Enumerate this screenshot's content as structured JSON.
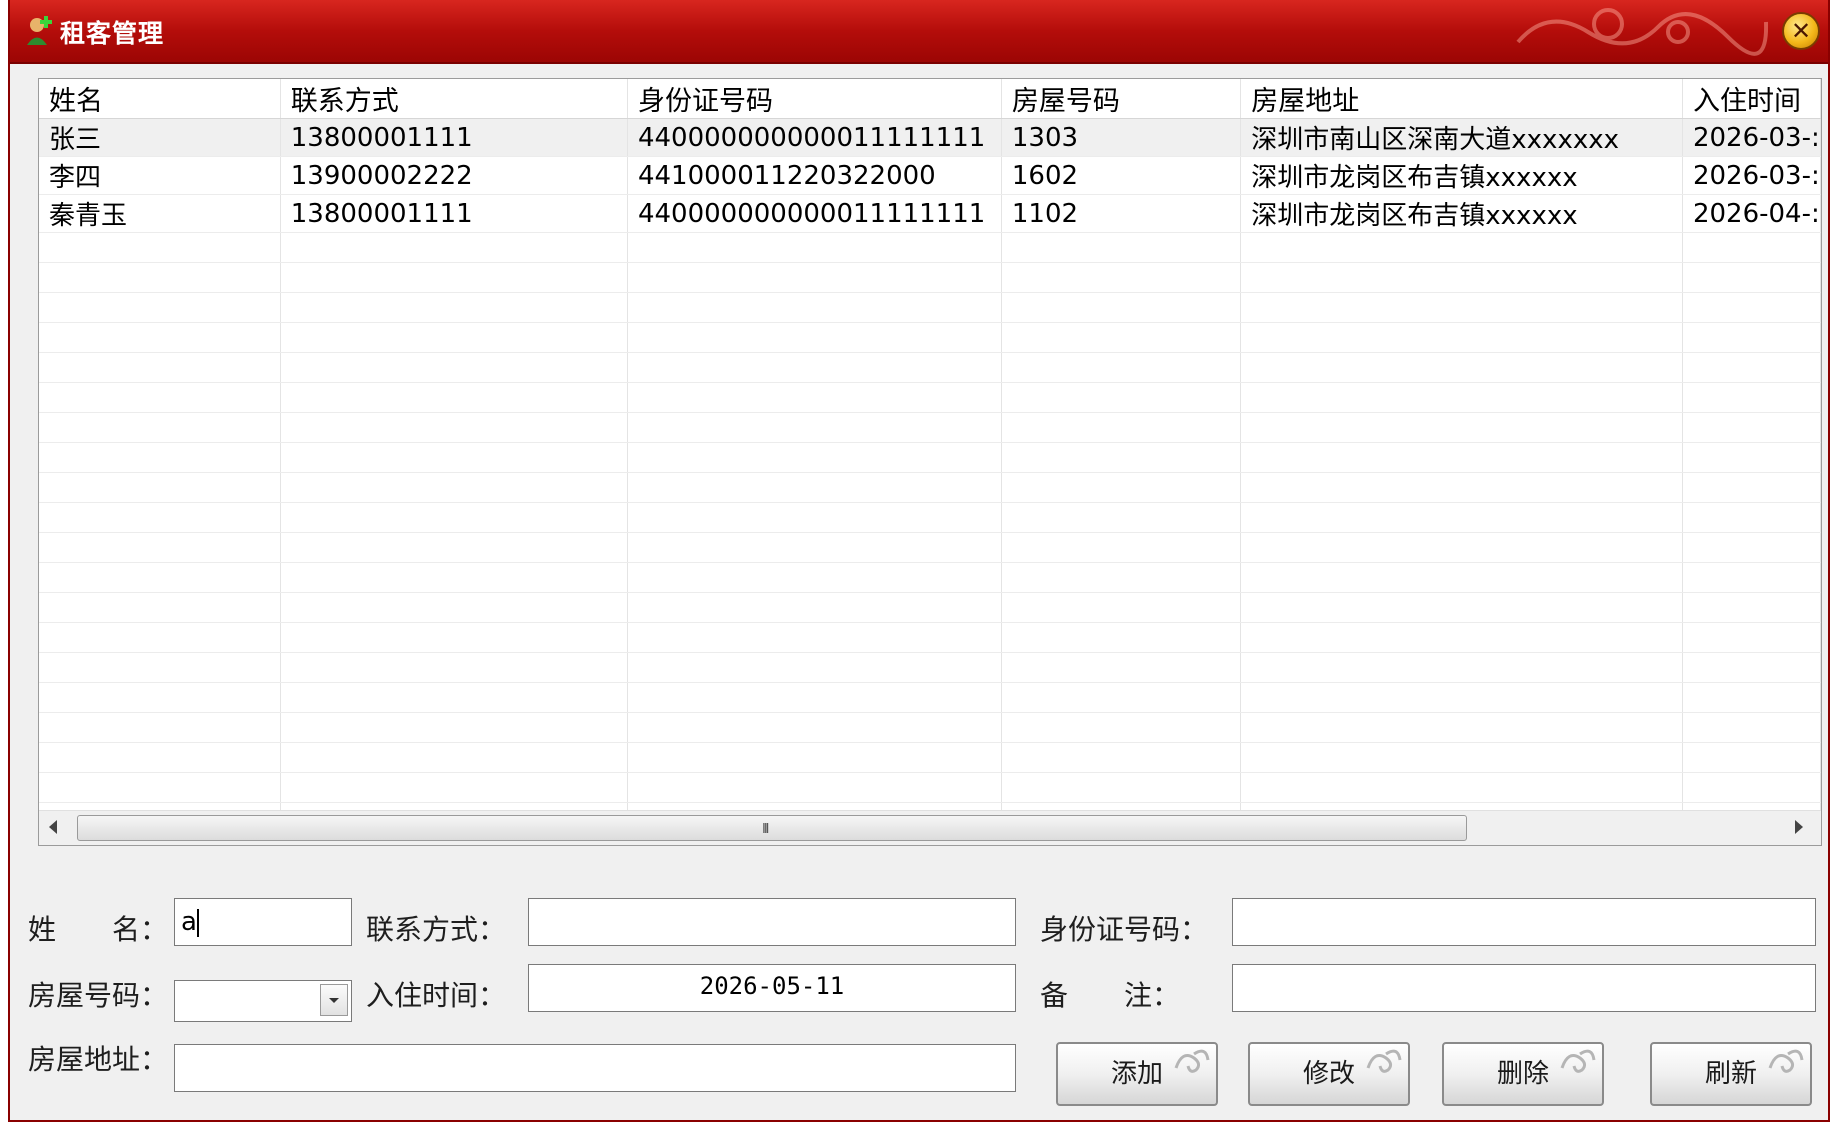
{
  "window": {
    "title": "租客管理"
  },
  "grid": {
    "columns": [
      "姓名",
      "联系方式",
      "身份证号码",
      "房屋号码",
      "房屋地址",
      "入住时间"
    ],
    "rows": [
      [
        "张三",
        "13800001111",
        "440000000000011111111",
        "1303",
        "深圳市南山区深南大道xxxxxxx",
        "2026-03-:"
      ],
      [
        "李四",
        "13900002222",
        "441000011220322000",
        "1602",
        "深圳市龙岗区布吉镇xxxxxx",
        "2026-03-:"
      ],
      [
        "秦青玉",
        "13800001111",
        "440000000000011111111",
        "1102",
        "深圳市龙岗区布吉镇xxxxxx",
        "2026-04-:"
      ]
    ],
    "scrollbar_grip": "III"
  },
  "form": {
    "name_label": "姓　　名：",
    "name_value": "a",
    "contact_label": "联系方式：",
    "contact_value": "",
    "id_label": "身份证号码：",
    "id_value": "",
    "room_label": "房屋号码：",
    "room_value": "",
    "checkin_label": "入住时间：",
    "checkin_value": "2026-05-11",
    "remark_label": "备　　注：",
    "remark_value": "",
    "address_label": "房屋地址：",
    "address_value": ""
  },
  "buttons": {
    "add": "添加",
    "edit": "修改",
    "delete": "删除",
    "refresh": "刷新"
  },
  "colors": {
    "titlebar": "#b40d0a",
    "window_bg": "#f0f0f0"
  },
  "icons": [
    "user-add-icon",
    "close-icon",
    "scroll-left-icon",
    "scroll-right-icon",
    "dropdown-arrow-icon"
  ]
}
